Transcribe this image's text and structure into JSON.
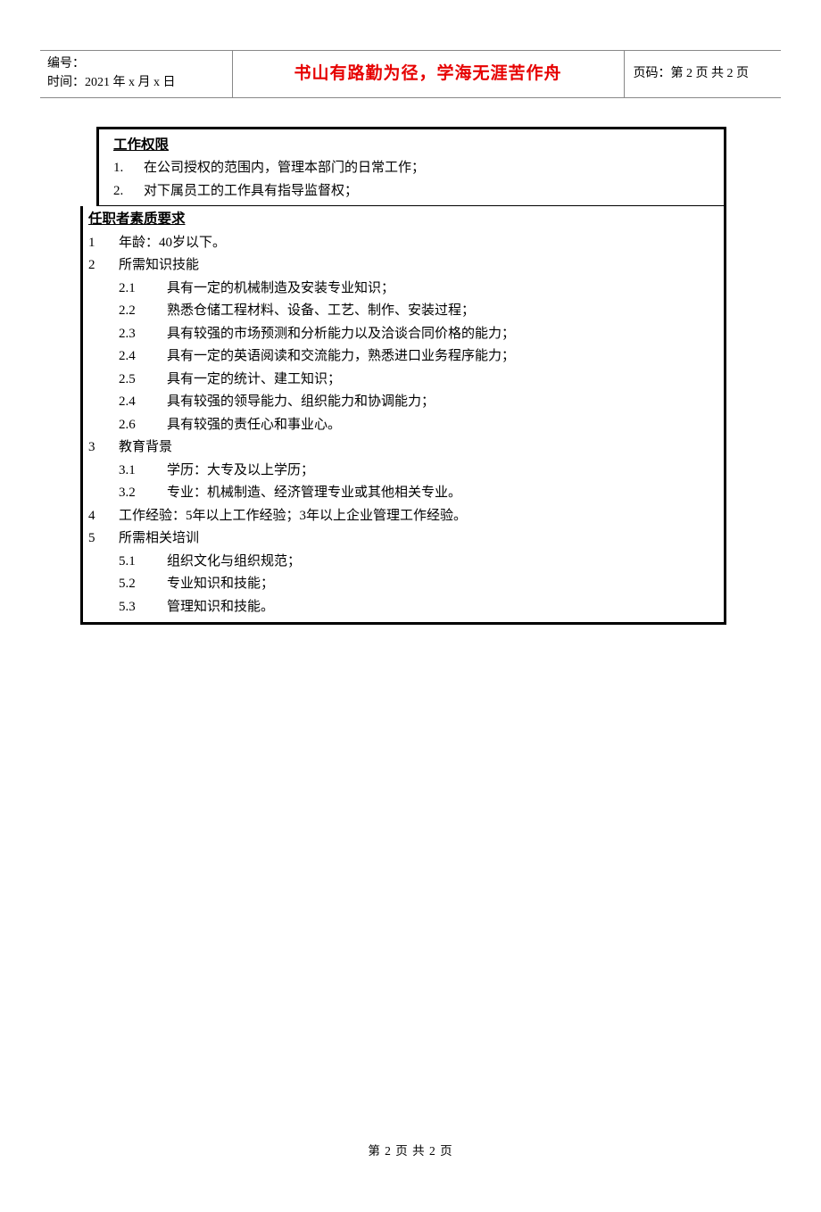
{
  "header": {
    "serial_label": "编号：",
    "time_label": "时间：2021 年 x 月 x 日",
    "motto": "书山有路勤为径，学海无涯苦作舟",
    "page_label": "页码：第 2 页  共 2 页"
  },
  "section1": {
    "title": "工作权限",
    "items": [
      {
        "num": "1.",
        "text": "在公司授权的范围内，管理本部门的日常工作；"
      },
      {
        "num": "2.",
        "text": "对下属员工的工作具有指导监督权；"
      }
    ]
  },
  "section2": {
    "title": "任职者素质要求",
    "items": [
      {
        "num": "1",
        "text": "年龄：40岁以下。",
        "sub": []
      },
      {
        "num": "2",
        "text": "所需知识技能",
        "sub": [
          {
            "num": "2.1",
            "text": "具有一定的机械制造及安装专业知识；"
          },
          {
            "num": "2.2",
            "text": "熟悉仓储工程材料、设备、工艺、制作、安装过程；"
          },
          {
            "num": "2.3",
            "text": "具有较强的市场预测和分析能力以及洽谈合同价格的能力；"
          },
          {
            "num": "2.4",
            "text": "具有一定的英语阅读和交流能力，熟悉进口业务程序能力；"
          },
          {
            "num": "2.5",
            "text": "具有一定的统计、建工知识；"
          },
          {
            "num": "2.4",
            "text": "具有较强的领导能力、组织能力和协调能力；"
          },
          {
            "num": "2.6",
            "text": "具有较强的责任心和事业心。"
          }
        ]
      },
      {
        "num": "3",
        "text": "教育背景",
        "sub": [
          {
            "num": "3.1",
            "text": "学历：大专及以上学历；"
          },
          {
            "num": "3.2",
            "text": "专业：机械制造、经济管理专业或其他相关专业。"
          }
        ]
      },
      {
        "num": "4",
        "text": "工作经验：5年以上工作经验；3年以上企业管理工作经验。",
        "sub": []
      },
      {
        "num": "5",
        "text": "所需相关培训",
        "sub": [
          {
            "num": "5.1",
            "text": "组织文化与组织规范；"
          },
          {
            "num": "5.2",
            "text": "专业知识和技能；"
          },
          {
            "num": "5.3",
            "text": "管理知识和技能。"
          }
        ]
      }
    ]
  },
  "footer": "第 2 页 共 2 页"
}
